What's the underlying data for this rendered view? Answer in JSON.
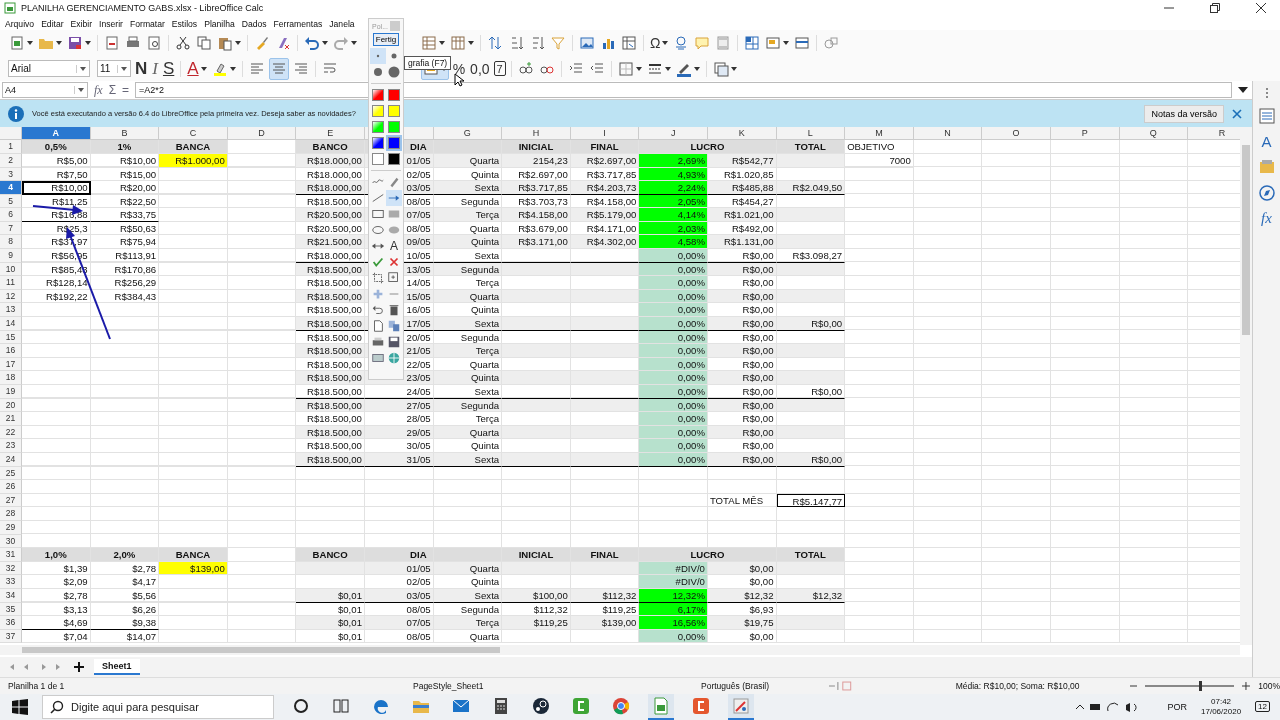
{
  "window": {
    "title": "PLANILHA GERENCIAMENTO GABS.xlsx - LibreOffice Calc"
  },
  "menu": [
    "Arquivo",
    "Editar",
    "Exibir",
    "Inserir",
    "Formatar",
    "Estilos",
    "Planilha",
    "Dados",
    "Ferramentas",
    "Janela"
  ],
  "toolbar": {
    "omega": "Ω",
    "font": "Arial",
    "size": "11",
    "bold": "N",
    "italic": "I",
    "underline": "S",
    "font_color": "A",
    "alignment": [
      {
        "selected": false
      },
      {
        "selected": true
      },
      {
        "selected": false
      }
    ],
    "merge": {
      "selected": true
    },
    "percent": "%",
    "number": "0,0",
    "date": "7"
  },
  "formula_bar": {
    "cell": "A4",
    "icons": [
      "fx",
      "Σ",
      "="
    ],
    "formula": "=A2*2"
  },
  "infobar": {
    "message": "Você está executando a versão 6.4 do LibreOffice pela primeira vez. Deseja saber as novidades?",
    "button": "Notas da versão"
  },
  "palette": {
    "title": "Pol...",
    "button": "Fertig",
    "sizes": [
      {
        "selected": true
      },
      {
        "selected": false
      },
      {
        "selected": false
      },
      {
        "selected": false
      }
    ],
    "colors": [
      {
        "kind": "gradient",
        "color": "#ff0000",
        "selected": false
      },
      {
        "kind": "solid",
        "color": "#ff0000",
        "selected": false
      },
      {
        "kind": "gradient",
        "color": "#ffff00",
        "selected": false
      },
      {
        "kind": "solid",
        "color": "#ffff00",
        "selected": false
      },
      {
        "kind": "gradient",
        "color": "#00ff00",
        "selected": false
      },
      {
        "kind": "solid",
        "color": "#00ff00",
        "selected": false
      },
      {
        "kind": "gradient",
        "color": "#0000ff",
        "selected": false
      },
      {
        "kind": "solid",
        "color": "#0000ff",
        "selected": true
      },
      {
        "kind": "solid",
        "color": "#ffffff",
        "selected": false
      },
      {
        "kind": "solid",
        "color": "#000000",
        "selected": false
      }
    ],
    "tools": [
      {
        "kind": "curve",
        "selected": false
      },
      {
        "kind": "pen",
        "selected": false
      },
      {
        "kind": "line",
        "selected": false
      },
      {
        "kind": "arrow",
        "selected": true
      },
      {
        "kind": "rect",
        "selected": false
      },
      {
        "kind": "rect_filled",
        "selected": false
      },
      {
        "kind": "ellipse",
        "selected": false
      },
      {
        "kind": "ellipse_filled",
        "selected": false
      },
      {
        "kind": "double_arrow",
        "selected": false
      },
      {
        "kind": "text",
        "label": "A",
        "selected": false
      },
      {
        "kind": "check",
        "selected": false
      },
      {
        "kind": "cross",
        "selected": false
      },
      {
        "kind": "crop",
        "selected": false
      },
      {
        "kind": "zoom",
        "selected": false
      },
      {
        "kind": "plus",
        "selected": false
      },
      {
        "kind": "minus",
        "selected": false
      },
      {
        "kind": "undo",
        "selected": false
      },
      {
        "kind": "trash",
        "selected": false
      },
      {
        "kind": "page",
        "selected": false
      },
      {
        "kind": "copy",
        "selected": false
      },
      {
        "kind": "print",
        "selected": false
      },
      {
        "kind": "save",
        "selected": false
      },
      {
        "kind": "image",
        "selected": false
      },
      {
        "kind": "globe",
        "selected": false
      }
    ]
  },
  "tooltip": "grafia (F7)",
  "sheet": {
    "columns": [
      {
        "label": "A",
        "selected": true
      },
      {
        "label": "B",
        "selected": false
      },
      {
        "label": "C",
        "selected": false
      },
      {
        "label": "D",
        "selected": false
      },
      {
        "label": "E",
        "selected": false
      },
      {
        "selected": false
      },
      {
        "label": "G",
        "selected": false
      },
      {
        "label": "H",
        "selected": false
      },
      {
        "label": "I",
        "selected": false
      },
      {
        "label": "J",
        "selected": false
      },
      {
        "label": "K",
        "selected": false
      },
      {
        "label": "L",
        "selected": false
      },
      {
        "label": "M",
        "selected": false
      },
      {
        "label": "N",
        "selected": false
      },
      {
        "label": "O",
        "selected": false
      },
      {
        "label": "P",
        "selected": false
      },
      {
        "label": "Q",
        "selected": false
      },
      {
        "label": "R",
        "selected": false
      }
    ],
    "rows": [
      {
        "number": "1",
        "selected": false,
        "cells": [
          {
            "text": "0,5%",
            "kind": "head",
            "color": "#dddddd"
          },
          {
            "text": "1%",
            "kind": "head",
            "color": "#dddddd"
          },
          {
            "text": "BANCA",
            "kind": "head",
            "color": "#dddddd"
          },
          {},
          {
            "text": "BANCO",
            "kind": "head",
            "color": "#dddddd"
          },
          {
            "text": "DIA",
            "kind": "head_right",
            "color": "#dddddd"
          },
          {
            "kind": "head",
            "color": "#dddddd"
          },
          {
            "text": "INICIAL",
            "kind": "head",
            "color": "#dddddd"
          },
          {
            "text": "FINAL",
            "kind": "head",
            "color": "#dddddd"
          },
          {
            "text": "LUCRO",
            "kind": "head_wide",
            "color": "#dddddd"
          },
          {
            "text": "TOTAL",
            "kind": "head",
            "color": "#dddddd"
          },
          {
            "text": "OBJETIVO",
            "kind": "label"
          }
        ]
      },
      {
        "number": "2",
        "selected": false,
        "cells": [
          {
            "text": "R$5,00",
            "kind": "value"
          },
          {
            "text": "R$10,00",
            "kind": "value"
          },
          {
            "text": "R$1.000,00",
            "kind": "value",
            "color": "#ffff00"
          },
          {},
          {
            "text": "R$18.000,00",
            "kind": "value",
            "color": "#eeeeee"
          },
          {
            "text": "01/05",
            "kind": "value",
            "color": "#eeeeee"
          },
          {
            "text": "Quarta",
            "kind": "value",
            "color": "#eeeeee"
          },
          {
            "text": "2154,23",
            "kind": "value",
            "color": "#eeeeee"
          },
          {
            "text": "R$2.697,00",
            "kind": "value",
            "color": "#eeeeee"
          },
          {
            "text": "2,69%",
            "kind": "value",
            "color": "#00ff00"
          },
          {
            "text": "R$542,77",
            "kind": "value",
            "color": "#eeeeee"
          },
          {
            "kind": "value",
            "color": "#eeeeee"
          },
          {
            "text": "7000",
            "kind": "value"
          }
        ]
      },
      {
        "number": "3",
        "selected": false,
        "cells": [
          {
            "text": "R$7,50",
            "kind": "value"
          },
          {
            "text": "R$15,00",
            "kind": "value"
          },
          {},
          {},
          {
            "text": "R$18.000,00",
            "kind": "value"
          },
          {
            "text": "02/05",
            "kind": "value"
          },
          {
            "text": "Quinta",
            "kind": "value"
          },
          {
            "text": "R$2.697,00",
            "kind": "value"
          },
          {
            "text": "R$3.717,85",
            "kind": "value"
          },
          {
            "text": "4,93%",
            "kind": "value",
            "color": "#00ff00"
          },
          {
            "text": "R$1.020,85",
            "kind": "value"
          }
        ]
      },
      {
        "number": "4",
        "selected": true,
        "cells": [
          {
            "text": "R$10,00",
            "kind": "value"
          },
          {
            "text": "R$20,00",
            "kind": "value"
          },
          {},
          {},
          {
            "text": "R$18.000,00",
            "kind": "value",
            "color": "#eeeeee",
            "rule": true
          },
          {
            "text": "03/05",
            "kind": "value",
            "color": "#eeeeee",
            "rule": true
          },
          {
            "text": "Sexta",
            "kind": "value",
            "color": "#eeeeee",
            "rule": true
          },
          {
            "text": "R$3.717,85",
            "kind": "value",
            "color": "#eeeeee",
            "rule": true
          },
          {
            "text": "R$4.203,73",
            "kind": "value",
            "color": "#eeeeee",
            "rule": true
          },
          {
            "text": "2,24%",
            "kind": "value",
            "color": "#00ff00",
            "rule": true
          },
          {
            "text": "R$485,88",
            "kind": "value",
            "color": "#eeeeee",
            "rule": true
          },
          {
            "text": "R$2.049,50",
            "kind": "value",
            "color": "#eeeeee",
            "rule": true
          }
        ]
      },
      {
        "number": "5",
        "selected": false,
        "cells": [
          {
            "text": "R$11,25",
            "kind": "value"
          },
          {
            "text": "R$22,50",
            "kind": "value"
          },
          {},
          {},
          {
            "text": "R$18.500,00",
            "kind": "value"
          },
          {
            "text": "08/05",
            "kind": "value"
          },
          {
            "text": "Segunda",
            "kind": "value"
          },
          {
            "text": "R$3.703,73",
            "kind": "value"
          },
          {
            "text": "R$4.158,00",
            "kind": "value"
          },
          {
            "text": "2,05%",
            "kind": "value",
            "color": "#00ff00"
          },
          {
            "text": "R$454,27",
            "kind": "value"
          }
        ]
      },
      {
        "number": "6",
        "selected": false,
        "cells": [
          {
            "text": "R$16,88",
            "kind": "value",
            "rule": true
          },
          {
            "text": "R$33,75",
            "kind": "value",
            "rule": true
          },
          {},
          {},
          {
            "text": "R$20.500,00",
            "kind": "value",
            "color": "#eeeeee"
          },
          {
            "text": "07/05",
            "kind": "value",
            "color": "#eeeeee"
          },
          {
            "text": "Terça",
            "kind": "value",
            "color": "#eeeeee"
          },
          {
            "text": "R$4.158,00",
            "kind": "value",
            "color": "#eeeeee"
          },
          {
            "text": "R$5.179,00",
            "kind": "value",
            "color": "#eeeeee"
          },
          {
            "text": "4,14%",
            "kind": "value",
            "color": "#00ff00"
          },
          {
            "text": "R$1.021,00",
            "kind": "value",
            "color": "#eeeeee"
          },
          {
            "kind": "value",
            "color": "#eeeeee"
          }
        ]
      },
      {
        "number": "7",
        "selected": false,
        "cells": [
          {
            "text": "R$25,3",
            "kind": "value"
          },
          {
            "text": "R$50,63",
            "kind": "value"
          },
          {},
          {},
          {
            "text": "R$20.500,00",
            "kind": "value"
          },
          {
            "text": "08/05",
            "kind": "value"
          },
          {
            "text": "Quarta",
            "kind": "value"
          },
          {
            "text": "R$3.679,00",
            "kind": "value"
          },
          {
            "text": "R$4.171,00",
            "kind": "value"
          },
          {
            "text": "2,03%",
            "kind": "value",
            "color": "#00ff00"
          },
          {
            "text": "R$492,00",
            "kind": "value"
          }
        ]
      },
      {
        "number": "8",
        "selected": false,
        "cells": [
          {
            "text": "R$37,97",
            "kind": "value"
          },
          {
            "text": "R$75,94",
            "kind": "value"
          },
          {},
          {},
          {
            "text": "R$21.500,00",
            "kind": "value",
            "color": "#eeeeee"
          },
          {
            "text": "09/05",
            "kind": "value",
            "color": "#eeeeee"
          },
          {
            "text": "Quinta",
            "kind": "value",
            "color": "#eeeeee"
          },
          {
            "text": "R$3.171,00",
            "kind": "value",
            "color": "#eeeeee"
          },
          {
            "text": "R$4.302,00",
            "kind": "value",
            "color": "#eeeeee"
          },
          {
            "text": "4,58%",
            "kind": "value",
            "color": "#00ff00"
          },
          {
            "text": "R$1.131,00",
            "kind": "value",
            "color": "#eeeeee"
          },
          {
            "kind": "value",
            "color": "#eeeeee"
          }
        ]
      },
      {
        "number": "9",
        "selected": false,
        "cells": [
          {
            "text": "R$56,95",
            "kind": "value"
          },
          {
            "text": "R$113,91",
            "kind": "value"
          },
          {},
          {},
          {
            "text": "R$18.000,00",
            "kind": "value",
            "rule": true
          },
          {
            "text": "10/05",
            "kind": "value",
            "rule": true
          },
          {
            "text": "Sexta",
            "kind": "value",
            "rule": true
          },
          {
            "kind": "value",
            "rule": true
          },
          {
            "kind": "value",
            "rule": true
          },
          {
            "text": "0,00%",
            "kind": "value",
            "color": "#b7e1cd",
            "rule": true
          },
          {
            "text": "R$0,00",
            "kind": "value",
            "rule": true
          },
          {
            "text": "R$3.098,27",
            "kind": "value",
            "rule": true
          }
        ]
      },
      {
        "number": "10",
        "selected": false,
        "cells": [
          {
            "text": "R$85,43",
            "kind": "value"
          },
          {
            "text": "R$170,86",
            "kind": "value"
          },
          {},
          {},
          {
            "text": "R$18.500,00",
            "kind": "value",
            "color": "#eeeeee"
          },
          {
            "text": "13/05",
            "kind": "value",
            "color": "#eeeeee"
          },
          {
            "text": "Segunda",
            "kind": "value",
            "color": "#eeeeee"
          },
          {
            "kind": "value",
            "color": "#eeeeee"
          },
          {
            "kind": "value",
            "color": "#eeeeee"
          },
          {
            "text": "0,00%",
            "kind": "value",
            "color": "#b7e1cd"
          },
          {
            "text": "R$0,00",
            "kind": "value",
            "color": "#eeeeee"
          },
          {
            "kind": "value",
            "color": "#eeeeee"
          }
        ]
      },
      {
        "number": "11",
        "selected": false,
        "cells": [
          {
            "text": "R$128,14",
            "kind": "value"
          },
          {
            "text": "R$256,29",
            "kind": "value"
          },
          {},
          {},
          {
            "text": "R$18.500,00",
            "kind": "value"
          },
          {
            "text": "14/05",
            "kind": "value"
          },
          {
            "text": "Terça",
            "kind": "value"
          },
          {},
          {},
          {
            "text": "0,00%",
            "kind": "value",
            "color": "#b7e1cd"
          },
          {
            "text": "R$0,00",
            "kind": "value"
          }
        ]
      },
      {
        "number": "12",
        "selected": false,
        "cells": [
          {
            "text": "R$192,22",
            "kind": "value"
          },
          {
            "text": "R$384,43",
            "kind": "value"
          },
          {},
          {},
          {
            "text": "R$18.500,00",
            "kind": "value",
            "color": "#eeeeee"
          },
          {
            "text": "15/05",
            "kind": "value",
            "color": "#eeeeee"
          },
          {
            "text": "Quarta",
            "kind": "value",
            "color": "#eeeeee"
          },
          {
            "kind": "value",
            "color": "#eeeeee"
          },
          {
            "kind": "value",
            "color": "#eeeeee"
          },
          {
            "text": "0,00%",
            "kind": "value",
            "color": "#b7e1cd"
          },
          {
            "text": "R$0,00",
            "kind": "value",
            "color": "#eeeeee"
          },
          {
            "kind": "value",
            "color": "#eeeeee"
          }
        ]
      },
      {
        "number": "13",
        "selected": false,
        "cells": [
          {},
          {},
          {},
          {},
          {
            "text": "R$18.500,00",
            "kind": "value"
          },
          {
            "text": "16/05",
            "kind": "value"
          },
          {
            "text": "Quinta",
            "kind": "value"
          },
          {},
          {},
          {
            "text": "0,00%",
            "kind": "value",
            "color": "#b7e1cd"
          },
          {
            "text": "R$0,00",
            "kind": "value"
          }
        ]
      },
      {
        "number": "14",
        "selected": false,
        "cells": [
          {},
          {},
          {},
          {},
          {
            "text": "R$18.500,00",
            "kind": "value",
            "color": "#eeeeee",
            "rule": true
          },
          {
            "text": "17/05",
            "kind": "value",
            "color": "#eeeeee",
            "rule": true
          },
          {
            "text": "Sexta",
            "kind": "value",
            "color": "#eeeeee",
            "rule": true
          },
          {
            "kind": "value",
            "color": "#eeeeee",
            "rule": true
          },
          {
            "kind": "value",
            "color": "#eeeeee",
            "rule": true
          },
          {
            "text": "0,00%",
            "kind": "value",
            "color": "#b7e1cd",
            "rule": true
          },
          {
            "text": "R$0,00",
            "kind": "value",
            "color": "#eeeeee",
            "rule": true
          },
          {
            "text": "R$0,00",
            "kind": "value",
            "color": "#eeeeee",
            "rule": true
          }
        ]
      },
      {
        "number": "15",
        "selected": false,
        "cells": [
          {},
          {},
          {},
          {},
          {
            "text": "R$18.500,00",
            "kind": "value"
          },
          {
            "text": "20/05",
            "kind": "value"
          },
          {
            "text": "Segunda",
            "kind": "value"
          },
          {},
          {},
          {
            "text": "0,00%",
            "kind": "value",
            "color": "#b7e1cd"
          },
          {
            "text": "R$0,00",
            "kind": "value"
          }
        ]
      },
      {
        "number": "16",
        "selected": false,
        "cells": [
          {},
          {},
          {},
          {},
          {
            "text": "R$18.500,00",
            "kind": "value",
            "color": "#eeeeee"
          },
          {
            "text": "21/05",
            "kind": "value",
            "color": "#eeeeee"
          },
          {
            "text": "Terça",
            "kind": "value",
            "color": "#eeeeee"
          },
          {
            "kind": "value",
            "color": "#eeeeee"
          },
          {
            "kind": "value",
            "color": "#eeeeee"
          },
          {
            "text": "0,00%",
            "kind": "value",
            "color": "#b7e1cd"
          },
          {
            "text": "R$0,00",
            "kind": "value",
            "color": "#eeeeee"
          },
          {
            "kind": "value",
            "color": "#eeeeee"
          }
        ]
      },
      {
        "number": "17",
        "selected": false,
        "cells": [
          {},
          {},
          {},
          {},
          {
            "text": "R$18.500,00",
            "kind": "value"
          },
          {
            "text": "22/05",
            "kind": "value"
          },
          {
            "text": "Quarta",
            "kind": "value"
          },
          {},
          {},
          {
            "text": "0,00%",
            "kind": "value",
            "color": "#b7e1cd"
          },
          {
            "text": "R$0,00",
            "kind": "value"
          }
        ]
      },
      {
        "number": "18",
        "selected": false,
        "cells": [
          {},
          {},
          {},
          {},
          {
            "text": "R$18.500,00",
            "kind": "value",
            "color": "#eeeeee"
          },
          {
            "text": "23/05",
            "kind": "value",
            "color": "#eeeeee"
          },
          {
            "text": "Quinta",
            "kind": "value",
            "color": "#eeeeee"
          },
          {
            "kind": "value",
            "color": "#eeeeee"
          },
          {
            "kind": "value",
            "color": "#eeeeee"
          },
          {
            "text": "0,00%",
            "kind": "value",
            "color": "#b7e1cd"
          },
          {
            "text": "R$0,00",
            "kind": "value",
            "color": "#eeeeee"
          },
          {
            "kind": "value",
            "color": "#eeeeee"
          }
        ]
      },
      {
        "number": "19",
        "selected": false,
        "cells": [
          {},
          {},
          {},
          {},
          {
            "text": "R$18.500,00",
            "kind": "value",
            "rule": true
          },
          {
            "text": "24/05",
            "kind": "value",
            "rule": true
          },
          {
            "text": "Sexta",
            "kind": "value",
            "rule": true
          },
          {
            "kind": "value",
            "rule": true
          },
          {
            "kind": "value",
            "rule": true
          },
          {
            "text": "0,00%",
            "kind": "value",
            "color": "#b7e1cd",
            "rule": true
          },
          {
            "text": "R$0,00",
            "kind": "value",
            "rule": true
          },
          {
            "text": "R$0,00",
            "kind": "value",
            "rule": true
          }
        ]
      },
      {
        "number": "20",
        "selected": false,
        "cells": [
          {},
          {},
          {},
          {},
          {
            "text": "R$18.500,00",
            "kind": "value",
            "color": "#eeeeee"
          },
          {
            "text": "27/05",
            "kind": "value",
            "color": "#eeeeee"
          },
          {
            "text": "Segunda",
            "kind": "value",
            "color": "#eeeeee"
          },
          {
            "kind": "value",
            "color": "#eeeeee"
          },
          {
            "kind": "value",
            "color": "#eeeeee"
          },
          {
            "text": "0,00%",
            "kind": "value",
            "color": "#b7e1cd"
          },
          {
            "text": "R$0,00",
            "kind": "value",
            "color": "#eeeeee"
          },
          {
            "kind": "value",
            "color": "#eeeeee"
          }
        ]
      },
      {
        "number": "21",
        "selected": false,
        "cells": [
          {},
          {},
          {},
          {},
          {
            "text": "R$18.500,00",
            "kind": "value"
          },
          {
            "text": "28/05",
            "kind": "value"
          },
          {
            "text": "Terça",
            "kind": "value"
          },
          {},
          {},
          {
            "text": "0,00%",
            "kind": "value",
            "color": "#b7e1cd"
          },
          {
            "text": "R$0,00",
            "kind": "value"
          }
        ]
      },
      {
        "number": "22",
        "selected": false,
        "cells": [
          {},
          {},
          {},
          {},
          {
            "text": "R$18.500,00",
            "kind": "value",
            "color": "#eeeeee"
          },
          {
            "text": "29/05",
            "kind": "value",
            "color": "#eeeeee"
          },
          {
            "text": "Quarta",
            "kind": "value",
            "color": "#eeeeee"
          },
          {
            "kind": "value",
            "color": "#eeeeee"
          },
          {
            "kind": "value",
            "color": "#eeeeee"
          },
          {
            "text": "0,00%",
            "kind": "value",
            "color": "#b7e1cd"
          },
          {
            "text": "R$0,00",
            "kind": "value",
            "color": "#eeeeee"
          },
          {
            "kind": "value",
            "color": "#eeeeee"
          }
        ]
      },
      {
        "number": "23",
        "selected": false,
        "cells": [
          {},
          {},
          {},
          {},
          {
            "text": "R$18.500,00",
            "kind": "value"
          },
          {
            "text": "30/05",
            "kind": "value"
          },
          {
            "text": "Quinta",
            "kind": "value"
          },
          {},
          {},
          {
            "text": "0,00%",
            "kind": "value",
            "color": "#b7e1cd"
          },
          {
            "text": "R$0,00",
            "kind": "value"
          }
        ]
      },
      {
        "number": "24",
        "selected": false,
        "cells": [
          {},
          {},
          {},
          {},
          {
            "text": "R$18.500,00",
            "kind": "value",
            "color": "#eeeeee",
            "rule": true
          },
          {
            "text": "31/05",
            "kind": "value",
            "color": "#eeeeee",
            "rule": true
          },
          {
            "text": "Sexta",
            "kind": "value",
            "color": "#eeeeee",
            "rule": true
          },
          {
            "kind": "value",
            "color": "#eeeeee",
            "rule": true
          },
          {
            "kind": "value",
            "color": "#eeeeee",
            "rule": true
          },
          {
            "text": "0,00%",
            "kind": "value",
            "color": "#b7e1cd",
            "rule": true
          },
          {
            "text": "R$0,00",
            "kind": "value",
            "color": "#eeeeee",
            "rule": true
          },
          {
            "text": "R$0,00",
            "kind": "value",
            "color": "#eeeeee",
            "rule": true
          }
        ]
      },
      {
        "number": "25",
        "selected": false,
        "cells": []
      },
      {
        "number": "26",
        "selected": false,
        "cells": []
      },
      {
        "number": "27",
        "selected": false,
        "cells": [
          {},
          {},
          {},
          {},
          {},
          {},
          {},
          {},
          {},
          {},
          {
            "text": "TOTAL MÊS",
            "kind": "label"
          },
          {
            "text": "R$5.147,77",
            "kind": "total"
          }
        ]
      },
      {
        "number": "28",
        "selected": false,
        "cells": []
      },
      {
        "number": "29",
        "selected": false,
        "cells": []
      },
      {
        "number": "30",
        "selected": false,
        "cells": []
      },
      {
        "number": "31",
        "selected": false,
        "cells": [
          {
            "text": "1,0%",
            "kind": "head",
            "color": "#dddddd"
          },
          {
            "text": "2,0%",
            "kind": "head",
            "color": "#dddddd"
          },
          {
            "text": "BANCA",
            "kind": "head",
            "color": "#dddddd"
          },
          {},
          {
            "text": "BANCO",
            "kind": "head",
            "color": "#dddddd"
          },
          {
            "text": "DIA",
            "kind": "head_right",
            "color": "#dddddd"
          },
          {
            "kind": "head",
            "color": "#dddddd"
          },
          {
            "text": "INICIAL",
            "kind": "head",
            "color": "#dddddd"
          },
          {
            "text": "FINAL",
            "kind": "head",
            "color": "#dddddd"
          },
          {
            "text": "LUCRO",
            "kind": "head_wide",
            "color": "#dddddd"
          },
          {
            "text": "TOTAL",
            "kind": "head",
            "color": "#dddddd"
          }
        ]
      },
      {
        "number": "32",
        "selected": false,
        "cells": [
          {
            "text": "$1,39",
            "kind": "value"
          },
          {
            "text": "$2,78",
            "kind": "value"
          },
          {
            "text": "$139,00",
            "kind": "value",
            "color": "#ffff00"
          },
          {},
          {
            "kind": "value",
            "color": "#eeeeee"
          },
          {
            "text": "01/05",
            "kind": "value",
            "color": "#eeeeee"
          },
          {
            "text": "Quarta",
            "kind": "value",
            "color": "#eeeeee"
          },
          {
            "kind": "value",
            "color": "#eeeeee"
          },
          {
            "kind": "value",
            "color": "#eeeeee"
          },
          {
            "text": "#DIV/0",
            "kind": "value",
            "color": "#b7e1cd"
          },
          {
            "text": "$0,00",
            "kind": "value",
            "color": "#eeeeee"
          },
          {
            "kind": "value",
            "color": "#eeeeee"
          }
        ]
      },
      {
        "number": "33",
        "selected": false,
        "cells": [
          {
            "text": "$2,09",
            "kind": "value"
          },
          {
            "text": "$4,17",
            "kind": "value"
          },
          {},
          {},
          {},
          {
            "text": "02/05",
            "kind": "value"
          },
          {
            "text": "Quinta",
            "kind": "value"
          },
          {},
          {},
          {
            "text": "#DIV/0",
            "kind": "value",
            "color": "#b7e1cd"
          },
          {
            "text": "$0,00",
            "kind": "value"
          }
        ]
      },
      {
        "number": "34",
        "selected": false,
        "cells": [
          {
            "text": "$2,78",
            "kind": "value"
          },
          {
            "text": "$5,56",
            "kind": "value"
          },
          {},
          {},
          {
            "text": "$0,01",
            "kind": "value",
            "color": "#eeeeee",
            "rule": true
          },
          {
            "text": "03/05",
            "kind": "value",
            "color": "#eeeeee",
            "rule": true
          },
          {
            "text": "Sexta",
            "kind": "value",
            "color": "#eeeeee",
            "rule": true
          },
          {
            "text": "$100,00",
            "kind": "value",
            "color": "#eeeeee",
            "rule": true
          },
          {
            "text": "$112,32",
            "kind": "value",
            "color": "#eeeeee",
            "rule": true
          },
          {
            "text": "12,32%",
            "kind": "value",
            "color": "#00ff00",
            "rule": true
          },
          {
            "text": "$12,32",
            "kind": "value",
            "color": "#eeeeee",
            "rule": true
          },
          {
            "text": "$12,32",
            "kind": "value",
            "color": "#eeeeee",
            "rule": true
          }
        ]
      },
      {
        "number": "35",
        "selected": false,
        "cells": [
          {
            "text": "$3,13",
            "kind": "value"
          },
          {
            "text": "$6,26",
            "kind": "value"
          },
          {},
          {},
          {
            "text": "$0,01",
            "kind": "value"
          },
          {
            "text": "08/05",
            "kind": "value"
          },
          {
            "text": "Segunda",
            "kind": "value"
          },
          {
            "text": "$112,32",
            "kind": "value"
          },
          {
            "text": "$119,25",
            "kind": "value"
          },
          {
            "text": "6,17%",
            "kind": "value",
            "color": "#00ff00"
          },
          {
            "text": "$6,93",
            "kind": "value"
          }
        ]
      },
      {
        "number": "36",
        "selected": false,
        "cells": [
          {
            "text": "$4,69",
            "kind": "value",
            "rule": true
          },
          {
            "text": "$9,38",
            "kind": "value",
            "rule": true
          },
          {},
          {},
          {
            "text": "$0,01",
            "kind": "value",
            "color": "#eeeeee"
          },
          {
            "text": "07/05",
            "kind": "value",
            "color": "#eeeeee"
          },
          {
            "text": "Terça",
            "kind": "value",
            "color": "#eeeeee"
          },
          {
            "text": "$119,25",
            "kind": "value",
            "color": "#eeeeee"
          },
          {
            "text": "$139,00",
            "kind": "value",
            "color": "#eeeeee"
          },
          {
            "text": "16,56%",
            "kind": "value",
            "color": "#00ff00"
          },
          {
            "text": "$19,75",
            "kind": "value",
            "color": "#eeeeee"
          },
          {
            "kind": "value",
            "color": "#eeeeee"
          }
        ]
      },
      {
        "number": "37",
        "selected": false,
        "cells": [
          {
            "text": "$7,04",
            "kind": "value"
          },
          {
            "text": "$14,07",
            "kind": "value"
          },
          {},
          {},
          {
            "text": "$0,01",
            "kind": "value"
          },
          {
            "text": "08/05",
            "kind": "value"
          },
          {
            "text": "Quarta",
            "kind": "value"
          },
          {},
          {},
          {
            "text": "0,00%",
            "kind": "value",
            "color": "#b7e1cd"
          },
          {
            "text": "$0,00",
            "kind": "value"
          }
        ]
      }
    ]
  },
  "sidebar": [
    {
      "kind": "properties"
    },
    {
      "kind": "styles",
      "label": "A"
    },
    {
      "kind": "gallery"
    },
    {
      "kind": "navigator"
    },
    {
      "kind": "functions",
      "label": "fx"
    }
  ],
  "tabs": [
    {
      "label": "Sheet1",
      "selected": true
    }
  ],
  "status_bar": {
    "sheet": "Planilha 1 de 1",
    "page_style": "PageStyle_Sheet1",
    "language": "Português (Brasil)",
    "summary": "Média: R$10,00; Soma: R$10,00",
    "zoom": {
      "level": 0.6,
      "reading": "100%"
    }
  },
  "taskbar": {
    "search": {
      "placeholder": "Digite aqui para pesquisar"
    },
    "apps": [
      {
        "kind": "cortana",
        "active": false
      },
      {
        "kind": "taskview",
        "active": false
      },
      {
        "kind": "edge",
        "active": false
      },
      {
        "kind": "explorer",
        "active": false
      },
      {
        "kind": "mail",
        "active": false
      },
      {
        "kind": "calculator",
        "active": false
      },
      {
        "kind": "steam",
        "active": false
      },
      {
        "kind": "camtasia",
        "active": false
      },
      {
        "kind": "chrome",
        "active": false
      },
      {
        "kind": "calc",
        "active": true
      },
      {
        "kind": "recorder",
        "active": false
      },
      {
        "kind": "paint",
        "active": true
      }
    ],
    "language": "POR",
    "time": "07:42",
    "date": "17/06/2020",
    "notifications": "12"
  }
}
